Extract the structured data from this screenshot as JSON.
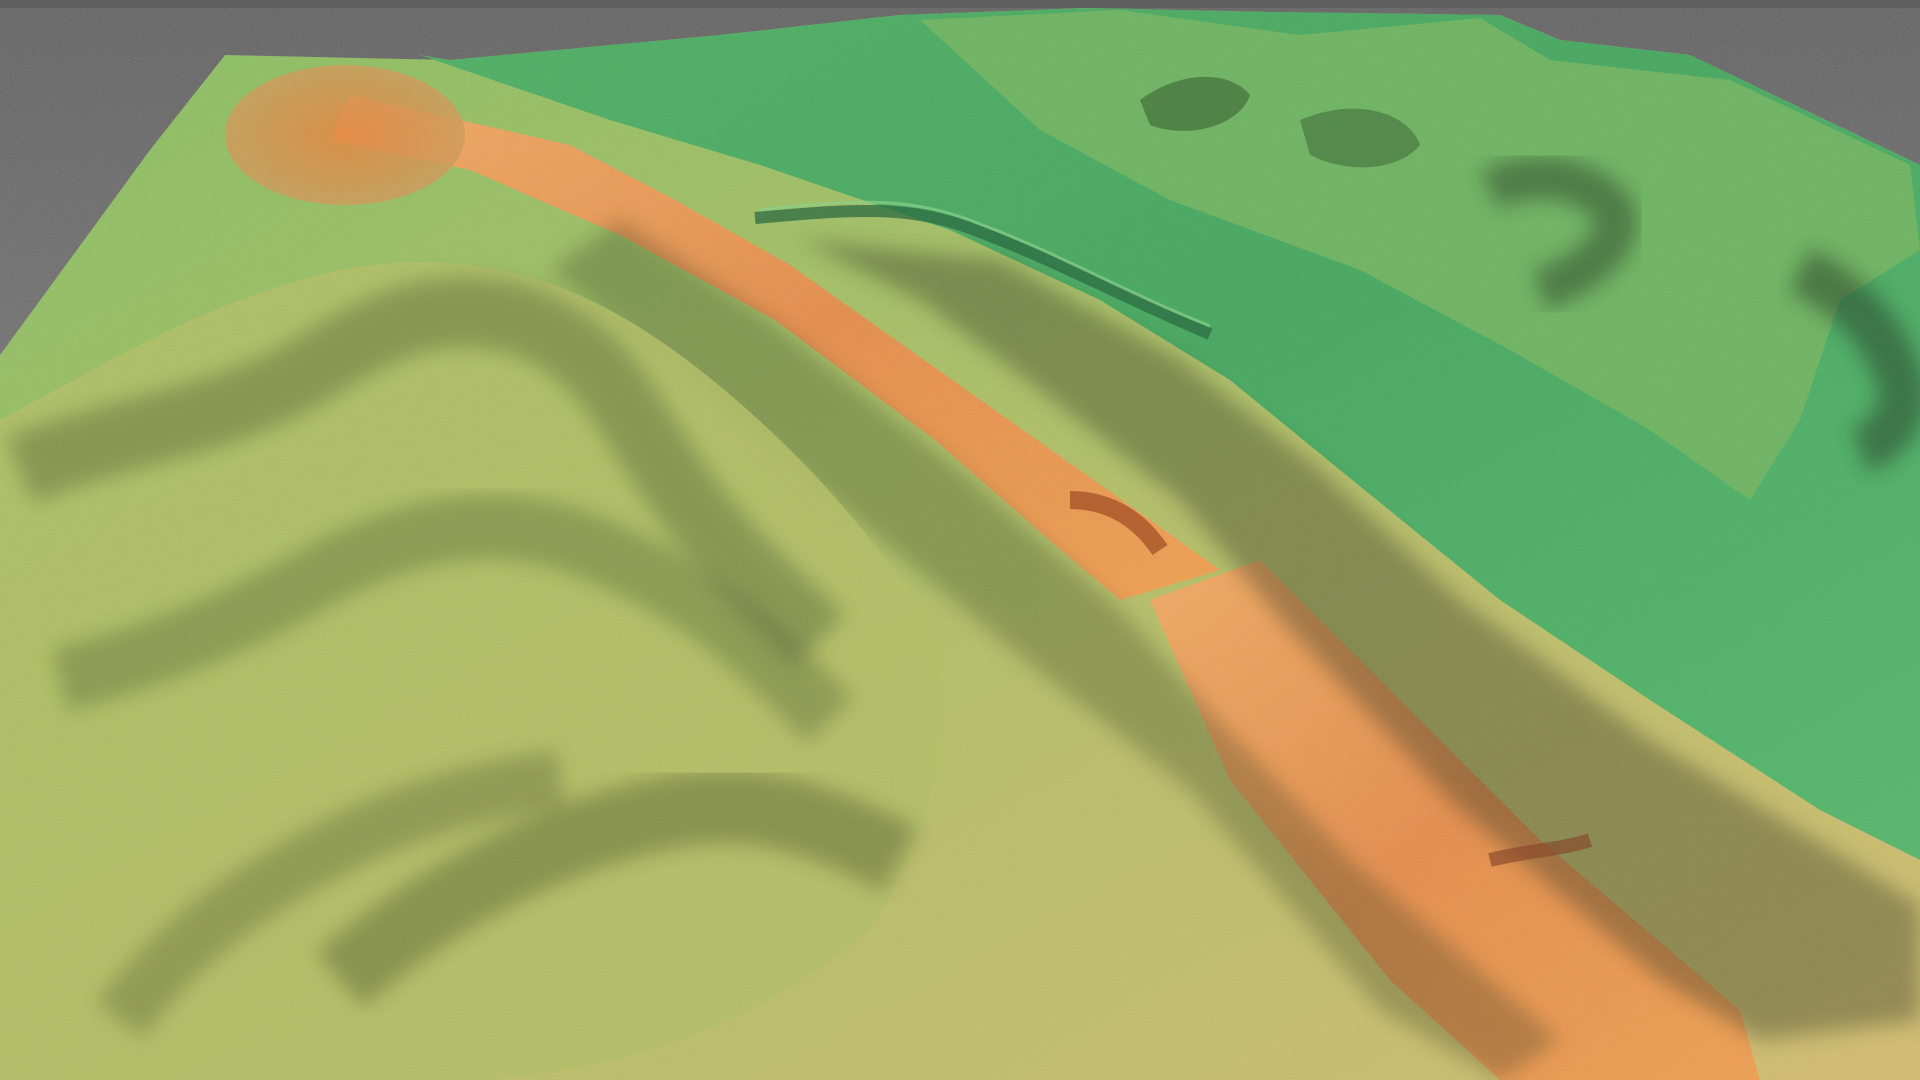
{
  "scene": {
    "type": "3d-lidar-terrain-model",
    "colors": {
      "background_top": "#5f5f5f",
      "background_bottom": "#8b8b8b",
      "low_elevation": "#4fae68",
      "mid_elevation": "#a9c466",
      "high_elevation": "#e08a45",
      "shadow": "#27341f"
    },
    "features": [
      "flat-green-floodplain",
      "river-channel",
      "raised-linear-earthwork",
      "rolling-hills",
      "small-mounds"
    ]
  }
}
